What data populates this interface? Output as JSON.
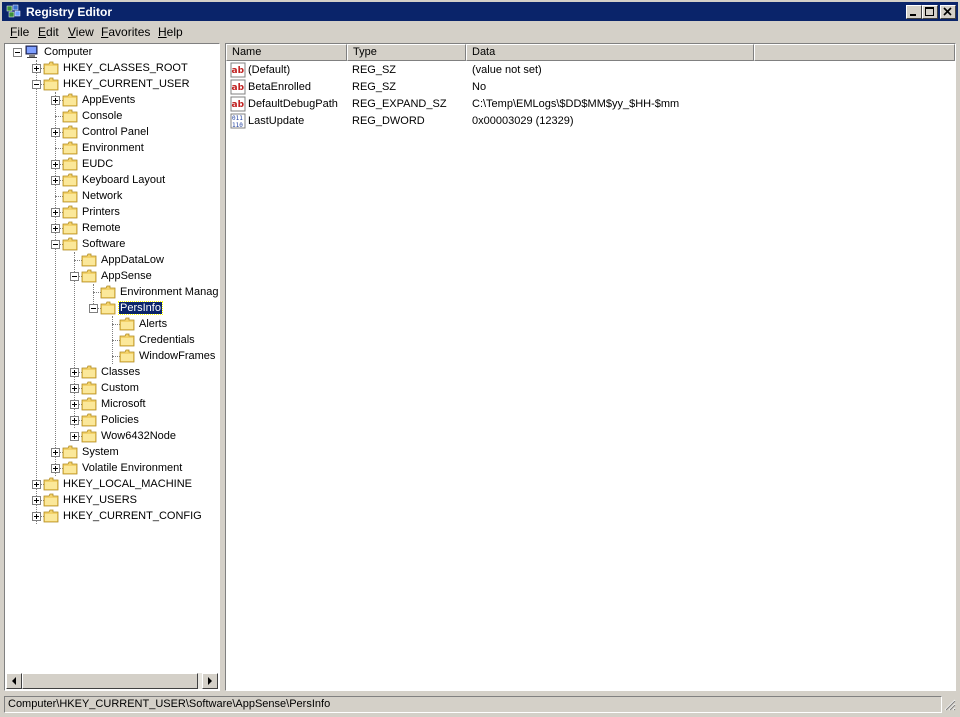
{
  "window": {
    "title": "Registry Editor"
  },
  "menu": [
    {
      "label": "File",
      "accel": "F",
      "rest": "ile"
    },
    {
      "label": "Edit",
      "accel": "E",
      "rest": "dit"
    },
    {
      "label": "View",
      "accel": "V",
      "rest": "iew"
    },
    {
      "label": "Favorites",
      "accel": "F",
      "rest": "avorites"
    },
    {
      "label": "Help",
      "accel": "H",
      "rest": "elp"
    }
  ],
  "tree": {
    "computer": "Computer",
    "hkcr": "HKEY_CLASSES_ROOT",
    "hkcu": "HKEY_CURRENT_USER",
    "appevents": "AppEvents",
    "console": "Console",
    "controlpanel": "Control Panel",
    "environment": "Environment",
    "eudc": "EUDC",
    "keyboardlayout": "Keyboard Layout",
    "network": "Network",
    "printers": "Printers",
    "remote": "Remote",
    "software": "Software",
    "appdatalow": "AppDataLow",
    "appsense": "AppSense",
    "envmanag": "Environment Manag",
    "persinfo": "PersInfo",
    "alerts": "Alerts",
    "credentials": "Credentials",
    "windowframes": "WindowFrames",
    "classes": "Classes",
    "custom": "Custom",
    "microsoft": "Microsoft",
    "policies": "Policies",
    "wow6432node": "Wow6432Node",
    "system": "System",
    "volatileenv": "Volatile Environment",
    "hklm": "HKEY_LOCAL_MACHINE",
    "hku": "HKEY_USERS",
    "hkcc": "HKEY_CURRENT_CONFIG"
  },
  "columns": {
    "name": "Name",
    "type": "Type",
    "data": "Data"
  },
  "values": [
    {
      "name": "(Default)",
      "type": "REG_SZ",
      "data": "(value not set)",
      "icon": "string-value-icon"
    },
    {
      "name": "BetaEnrolled",
      "type": "REG_SZ",
      "data": "No",
      "icon": "string-value-icon"
    },
    {
      "name": "DefaultDebugPath",
      "type": "REG_EXPAND_SZ",
      "data": "C:\\Temp\\EMLogs\\$DD$MM$yy_$HH-$mm",
      "icon": "string-value-icon"
    },
    {
      "name": "LastUpdate",
      "type": "REG_DWORD",
      "data": "0x00003029 (12329)",
      "icon": "binary-value-icon"
    }
  ],
  "status": {
    "path": "Computer\\HKEY_CURRENT_USER\\Software\\AppSense\\PersInfo"
  },
  "colors": {
    "titlebar": "#0a246a",
    "chrome": "#d4d0c8",
    "selection": "#0a246a",
    "folder": "#f3d26a"
  }
}
